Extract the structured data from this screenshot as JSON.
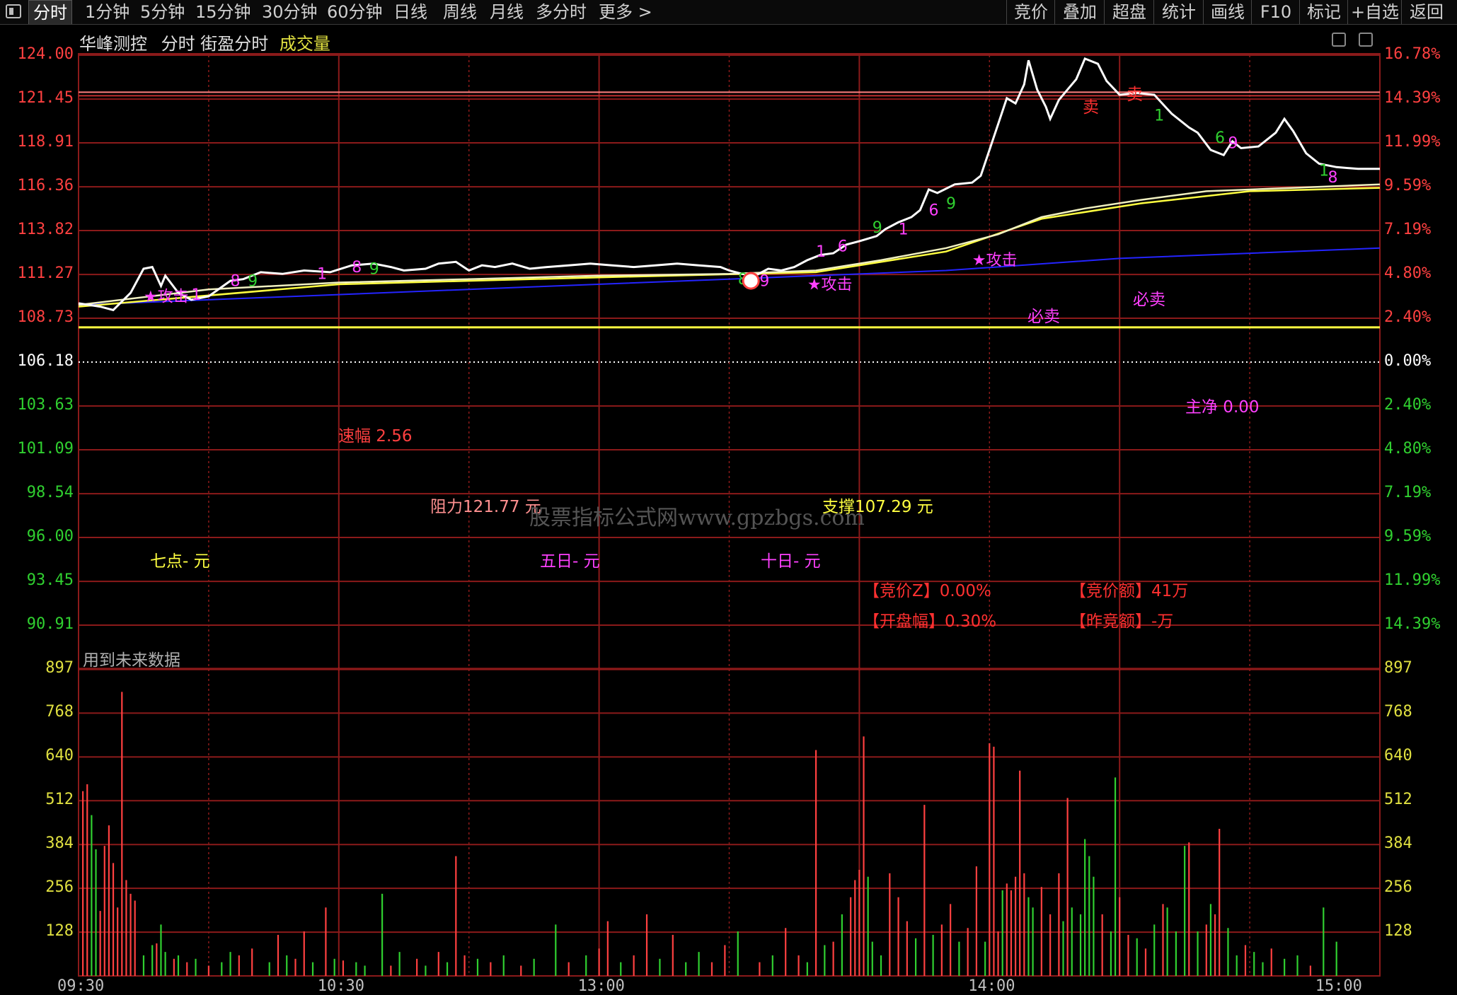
{
  "toolbar": {
    "tabs": [
      "分时",
      "1分钟",
      "5分钟",
      "15分钟",
      "30分钟",
      "60分钟",
      "日线",
      "周线",
      "月线",
      "多分时",
      "更多 >"
    ],
    "active_tab": "分时",
    "right_buttons": [
      "竞价",
      "叠加",
      "超盘",
      "统计",
      "画线",
      "F10",
      "标记",
      "+自选",
      "返回"
    ]
  },
  "header": {
    "stock_name": "华峰测控",
    "mode": "分时",
    "indicator": "街盈分时",
    "volume_label": "成交量"
  },
  "price_axis": {
    "left": [
      "124.00",
      "121.45",
      "118.91",
      "116.36",
      "113.82",
      "111.27",
      "108.73",
      "106.18",
      "103.63",
      "101.09",
      "98.54",
      "96.00",
      "93.45",
      "90.91"
    ],
    "right": [
      "16.78%",
      "14.39%",
      "11.99%",
      "9.59%",
      "7.19%",
      "4.80%",
      "2.40%",
      "0.00%",
      "2.40%",
      "4.80%",
      "7.19%",
      "9.59%",
      "11.99%",
      "14.39%"
    ],
    "pre_close": 106.18,
    "max": 124.0,
    "min": 90.91
  },
  "volume_axis": {
    "labels": [
      "897",
      "768",
      "640",
      "512",
      "384",
      "256",
      "128"
    ],
    "max": 897
  },
  "time_axis": [
    "09:30",
    "10:30",
    "13:00",
    "14:00",
    "15:00"
  ],
  "annotations": {
    "speed": "速幅 2.56",
    "resistance": "阻力121.77 元",
    "support": "支撑107.29 元",
    "watermark": "股票指标公式网www.gpzbgs.com",
    "qidian": "七点- 元",
    "wuri": "五日- 元",
    "shiri": "十日- 元",
    "zhujing": "主净 0.00",
    "jingjia_z": "【竞价Z】0.00%",
    "jingjia_e": "【竞价额】41万",
    "kaipan_fu": "【开盘幅】0.30%",
    "zuo_jing_e": "【昨竞额】-万",
    "future_data": "用到未来数据",
    "attack": "★攻击",
    "bimai": "必卖",
    "sell": "卖"
  },
  "colors": {
    "up": "#ff4040",
    "down": "#30d030",
    "grid": "#8b1a1a",
    "price": "#ffffff",
    "avg": "#ffff40",
    "blue": "#2020ff",
    "magenta": "#ff40ff"
  },
  "chart_data": {
    "type": "line",
    "price": [
      [
        0,
        109.6
      ],
      [
        5,
        109.4
      ],
      [
        8,
        109.2
      ],
      [
        12,
        110.2
      ],
      [
        15,
        111.6
      ],
      [
        17,
        111.7
      ],
      [
        19,
        110.6
      ],
      [
        20,
        111.2
      ],
      [
        23,
        110.2
      ],
      [
        26,
        109.8
      ],
      [
        30,
        110.0
      ],
      [
        35,
        110.9
      ],
      [
        38,
        111.0
      ],
      [
        42,
        111.4
      ],
      [
        47,
        111.3
      ],
      [
        52,
        111.5
      ],
      [
        58,
        111.4
      ],
      [
        63,
        111.8
      ],
      [
        68,
        111.9
      ],
      [
        72,
        111.7
      ],
      [
        75,
        111.5
      ],
      [
        80,
        111.6
      ],
      [
        83,
        111.9
      ],
      [
        87,
        112.0
      ],
      [
        90,
        111.5
      ],
      [
        93,
        111.8
      ],
      [
        96,
        111.7
      ],
      [
        100,
        111.9
      ],
      [
        104,
        111.6
      ],
      [
        108,
        111.7
      ],
      [
        113,
        111.8
      ],
      [
        118,
        111.9
      ],
      [
        123,
        111.8
      ],
      [
        128,
        111.7
      ],
      [
        133,
        111.8
      ],
      [
        138,
        111.9
      ],
      [
        143,
        111.8
      ],
      [
        148,
        111.7
      ],
      [
        150,
        111.5
      ],
      [
        153,
        111.3
      ],
      [
        156,
        111.2
      ],
      [
        159,
        111.6
      ],
      [
        162,
        111.5
      ],
      [
        165,
        111.7
      ],
      [
        168,
        112.1
      ],
      [
        171,
        112.4
      ],
      [
        174,
        112.5
      ],
      [
        177,
        113.0
      ],
      [
        180,
        113.2
      ],
      [
        184,
        113.5
      ],
      [
        186,
        113.9
      ],
      [
        189,
        114.3
      ],
      [
        192,
        114.6
      ],
      [
        194,
        115.0
      ],
      [
        196,
        116.2
      ],
      [
        198,
        116.0
      ],
      [
        202,
        116.5
      ],
      [
        206,
        116.6
      ],
      [
        208,
        117.0
      ],
      [
        210,
        118.5
      ],
      [
        212,
        120.0
      ],
      [
        214,
        121.5
      ],
      [
        216,
        121.2
      ],
      [
        218,
        122.3
      ],
      [
        219,
        123.7
      ],
      [
        221,
        122.0
      ],
      [
        223,
        121.0
      ],
      [
        224,
        120.3
      ],
      [
        226,
        121.4
      ],
      [
        228,
        122.0
      ],
      [
        230,
        122.6
      ],
      [
        232,
        123.8
      ],
      [
        235,
        123.5
      ],
      [
        237,
        122.5
      ],
      [
        240,
        121.7
      ],
      [
        244,
        121.8
      ],
      [
        248,
        121.7
      ],
      [
        252,
        120.6
      ],
      [
        256,
        119.8
      ],
      [
        258,
        119.5
      ],
      [
        261,
        118.5
      ],
      [
        264,
        118.2
      ],
      [
        266,
        119.0
      ],
      [
        268,
        118.6
      ],
      [
        272,
        118.7
      ],
      [
        276,
        119.5
      ],
      [
        278,
        120.3
      ],
      [
        280,
        119.6
      ],
      [
        283,
        118.3
      ],
      [
        286,
        117.7
      ],
      [
        290,
        117.5
      ],
      [
        295,
        117.4
      ],
      [
        300,
        117.4
      ]
    ],
    "average": [
      [
        0,
        109.5
      ],
      [
        30,
        110.4
      ],
      [
        60,
        110.8
      ],
      [
        90,
        111.0
      ],
      [
        120,
        111.2
      ],
      [
        150,
        111.3
      ],
      [
        170,
        111.5
      ],
      [
        185,
        112.1
      ],
      [
        200,
        112.8
      ],
      [
        212,
        113.6
      ],
      [
        222,
        114.6
      ],
      [
        232,
        115.1
      ],
      [
        245,
        115.6
      ],
      [
        260,
        116.1
      ],
      [
        280,
        116.3
      ],
      [
        300,
        116.5
      ]
    ],
    "avg_secondary": [
      [
        0,
        109.4
      ],
      [
        60,
        110.7
      ],
      [
        120,
        111.1
      ],
      [
        170,
        111.4
      ],
      [
        200,
        112.6
      ],
      [
        222,
        114.5
      ],
      [
        245,
        115.4
      ],
      [
        270,
        116.1
      ],
      [
        300,
        116.3
      ]
    ],
    "blue_line": [
      [
        0,
        109.5
      ],
      [
        100,
        110.5
      ],
      [
        150,
        111.0
      ],
      [
        200,
        111.5
      ],
      [
        240,
        112.2
      ],
      [
        300,
        112.8
      ]
    ],
    "yellow_flat": 108.2,
    "resistance_line": 121.77,
    "signal_labels_price": [
      {
        "t": 15,
        "p": 109.7,
        "text": "★攻击",
        "color": "#ff40ff"
      },
      {
        "t": 26,
        "p": 109.8,
        "text": "1",
        "color": "#ff40ff"
      },
      {
        "t": 35,
        "p": 110.6,
        "text": "8",
        "color": "#ff40ff"
      },
      {
        "t": 39,
        "p": 110.6,
        "text": "9",
        "color": "#30d030"
      },
      {
        "t": 55,
        "p": 111.0,
        "text": "1",
        "color": "#ff40ff"
      },
      {
        "t": 63,
        "p": 111.4,
        "text": "8",
        "color": "#ff40ff"
      },
      {
        "t": 67,
        "p": 111.3,
        "text": "9",
        "color": "#30d030"
      },
      {
        "t": 152,
        "p": 110.7,
        "text": "8",
        "color": "#30d030"
      },
      {
        "t": 157,
        "p": 110.6,
        "text": "9",
        "color": "#ff40ff"
      },
      {
        "t": 168,
        "p": 110.4,
        "text": "★攻击",
        "color": "#ff40ff"
      },
      {
        "t": 170,
        "p": 112.3,
        "text": "1",
        "color": "#ff40ff"
      },
      {
        "t": 175,
        "p": 112.6,
        "text": "6",
        "color": "#ff40ff"
      },
      {
        "t": 183,
        "p": 113.7,
        "text": "9",
        "color": "#30d030"
      },
      {
        "t": 189,
        "p": 113.6,
        "text": "1",
        "color": "#ff40ff"
      },
      {
        "t": 196,
        "p": 114.7,
        "text": "6",
        "color": "#ff40ff"
      },
      {
        "t": 200,
        "p": 115.1,
        "text": "9",
        "color": "#30d030"
      },
      {
        "t": 206,
        "p": 111.8,
        "text": "★攻击",
        "color": "#ff40ff"
      },
      {
        "t": 248,
        "p": 120.2,
        "text": "1",
        "color": "#30d030"
      },
      {
        "t": 262,
        "p": 118.9,
        "text": "6",
        "color": "#30d030"
      },
      {
        "t": 265,
        "p": 118.6,
        "text": "9",
        "color": "#ff40ff"
      },
      {
        "t": 286,
        "p": 117.0,
        "text": "1",
        "color": "#30d030"
      },
      {
        "t": 288,
        "p": 116.6,
        "text": "8",
        "color": "#ff40ff"
      }
    ],
    "volume": [
      [
        1,
        540,
        "u"
      ],
      [
        2,
        560,
        "u"
      ],
      [
        3,
        470,
        "d"
      ],
      [
        4,
        370,
        "d"
      ],
      [
        5,
        190,
        "u"
      ],
      [
        6,
        380,
        "u"
      ],
      [
        7,
        440,
        "u"
      ],
      [
        8,
        330,
        "u"
      ],
      [
        9,
        200,
        "u"
      ],
      [
        10,
        830,
        "u"
      ],
      [
        11,
        280,
        "u"
      ],
      [
        12,
        240,
        "u"
      ],
      [
        13,
        220,
        "u"
      ],
      [
        15,
        60,
        "d"
      ],
      [
        17,
        90,
        "d"
      ],
      [
        18,
        95,
        "u"
      ],
      [
        19,
        150,
        "d"
      ],
      [
        20,
        70,
        "d"
      ],
      [
        22,
        50,
        "u"
      ],
      [
        23,
        60,
        "d"
      ],
      [
        25,
        40,
        "u"
      ],
      [
        27,
        50,
        "d"
      ],
      [
        30,
        30,
        "u"
      ],
      [
        33,
        40,
        "d"
      ],
      [
        35,
        70,
        "d"
      ],
      [
        37,
        60,
        "u"
      ],
      [
        40,
        80,
        "u"
      ],
      [
        44,
        40,
        "d"
      ],
      [
        46,
        120,
        "u"
      ],
      [
        48,
        60,
        "d"
      ],
      [
        50,
        50,
        "u"
      ],
      [
        52,
        130,
        "u"
      ],
      [
        54,
        40,
        "d"
      ],
      [
        57,
        200,
        "u"
      ],
      [
        59,
        50,
        "d"
      ],
      [
        61,
        45,
        "u"
      ],
      [
        64,
        40,
        "d"
      ],
      [
        66,
        30,
        "d"
      ],
      [
        70,
        240,
        "d"
      ],
      [
        72,
        30,
        "u"
      ],
      [
        74,
        70,
        "d"
      ],
      [
        78,
        50,
        "u"
      ],
      [
        80,
        30,
        "d"
      ],
      [
        83,
        70,
        "u"
      ],
      [
        85,
        40,
        "d"
      ],
      [
        87,
        350,
        "u"
      ],
      [
        89,
        60,
        "u"
      ],
      [
        92,
        50,
        "d"
      ],
      [
        95,
        40,
        "u"
      ],
      [
        98,
        60,
        "d"
      ],
      [
        102,
        30,
        "u"
      ],
      [
        105,
        50,
        "d"
      ],
      [
        110,
        150,
        "d"
      ],
      [
        113,
        40,
        "u"
      ],
      [
        117,
        60,
        "d"
      ],
      [
        120,
        80,
        "u"
      ],
      [
        122,
        160,
        "u"
      ],
      [
        125,
        40,
        "d"
      ],
      [
        128,
        60,
        "u"
      ],
      [
        131,
        180,
        "u"
      ],
      [
        134,
        50,
        "d"
      ],
      [
        137,
        120,
        "u"
      ],
      [
        140,
        40,
        "d"
      ],
      [
        143,
        70,
        "d"
      ],
      [
        146,
        40,
        "u"
      ],
      [
        149,
        90,
        "u"
      ],
      [
        152,
        130,
        "d"
      ],
      [
        157,
        40,
        "u"
      ],
      [
        160,
        60,
        "d"
      ],
      [
        163,
        140,
        "u"
      ],
      [
        166,
        60,
        "u"
      ],
      [
        168,
        40,
        "d"
      ],
      [
        170,
        660,
        "u"
      ],
      [
        172,
        90,
        "d"
      ],
      [
        174,
        100,
        "u"
      ],
      [
        176,
        180,
        "d"
      ],
      [
        178,
        230,
        "u"
      ],
      [
        179,
        280,
        "u"
      ],
      [
        180,
        310,
        "u"
      ],
      [
        181,
        700,
        "u"
      ],
      [
        182,
        290,
        "d"
      ],
      [
        183,
        100,
        "d"
      ],
      [
        185,
        60,
        "d"
      ],
      [
        187,
        300,
        "u"
      ],
      [
        189,
        230,
        "u"
      ],
      [
        191,
        160,
        "u"
      ],
      [
        193,
        110,
        "d"
      ],
      [
        195,
        500,
        "u"
      ],
      [
        197,
        120,
        "d"
      ],
      [
        199,
        150,
        "u"
      ],
      [
        201,
        210,
        "u"
      ],
      [
        203,
        100,
        "d"
      ],
      [
        205,
        140,
        "u"
      ],
      [
        207,
        320,
        "u"
      ],
      [
        209,
        100,
        "d"
      ],
      [
        210,
        680,
        "u"
      ],
      [
        211,
        670,
        "u"
      ],
      [
        212,
        130,
        "u"
      ],
      [
        213,
        250,
        "d"
      ],
      [
        214,
        270,
        "u"
      ],
      [
        215,
        250,
        "u"
      ],
      [
        216,
        290,
        "u"
      ],
      [
        217,
        600,
        "u"
      ],
      [
        218,
        300,
        "u"
      ],
      [
        219,
        230,
        "d"
      ],
      [
        220,
        200,
        "d"
      ],
      [
        222,
        260,
        "u"
      ],
      [
        224,
        180,
        "u"
      ],
      [
        226,
        300,
        "u"
      ],
      [
        227,
        160,
        "d"
      ],
      [
        228,
        520,
        "u"
      ],
      [
        229,
        200,
        "d"
      ],
      [
        231,
        180,
        "d"
      ],
      [
        232,
        400,
        "d"
      ],
      [
        233,
        350,
        "d"
      ],
      [
        234,
        290,
        "d"
      ],
      [
        236,
        180,
        "u"
      ],
      [
        238,
        130,
        "d"
      ],
      [
        239,
        580,
        "d"
      ],
      [
        240,
        230,
        "u"
      ],
      [
        242,
        120,
        "u"
      ],
      [
        244,
        110,
        "d"
      ],
      [
        246,
        80,
        "u"
      ],
      [
        248,
        150,
        "d"
      ],
      [
        250,
        210,
        "u"
      ],
      [
        251,
        200,
        "d"
      ],
      [
        253,
        130,
        "d"
      ],
      [
        255,
        380,
        "d"
      ],
      [
        256,
        390,
        "u"
      ],
      [
        258,
        130,
        "d"
      ],
      [
        260,
        150,
        "u"
      ],
      [
        261,
        210,
        "d"
      ],
      [
        262,
        180,
        "u"
      ],
      [
        263,
        430,
        "u"
      ],
      [
        265,
        140,
        "d"
      ],
      [
        267,
        60,
        "d"
      ],
      [
        269,
        90,
        "u"
      ],
      [
        271,
        70,
        "d"
      ],
      [
        273,
        40,
        "d"
      ],
      [
        275,
        80,
        "u"
      ],
      [
        278,
        50,
        "d"
      ],
      [
        281,
        60,
        "d"
      ],
      [
        284,
        30,
        "u"
      ],
      [
        287,
        200,
        "d"
      ],
      [
        290,
        100,
        "d"
      ]
    ]
  }
}
